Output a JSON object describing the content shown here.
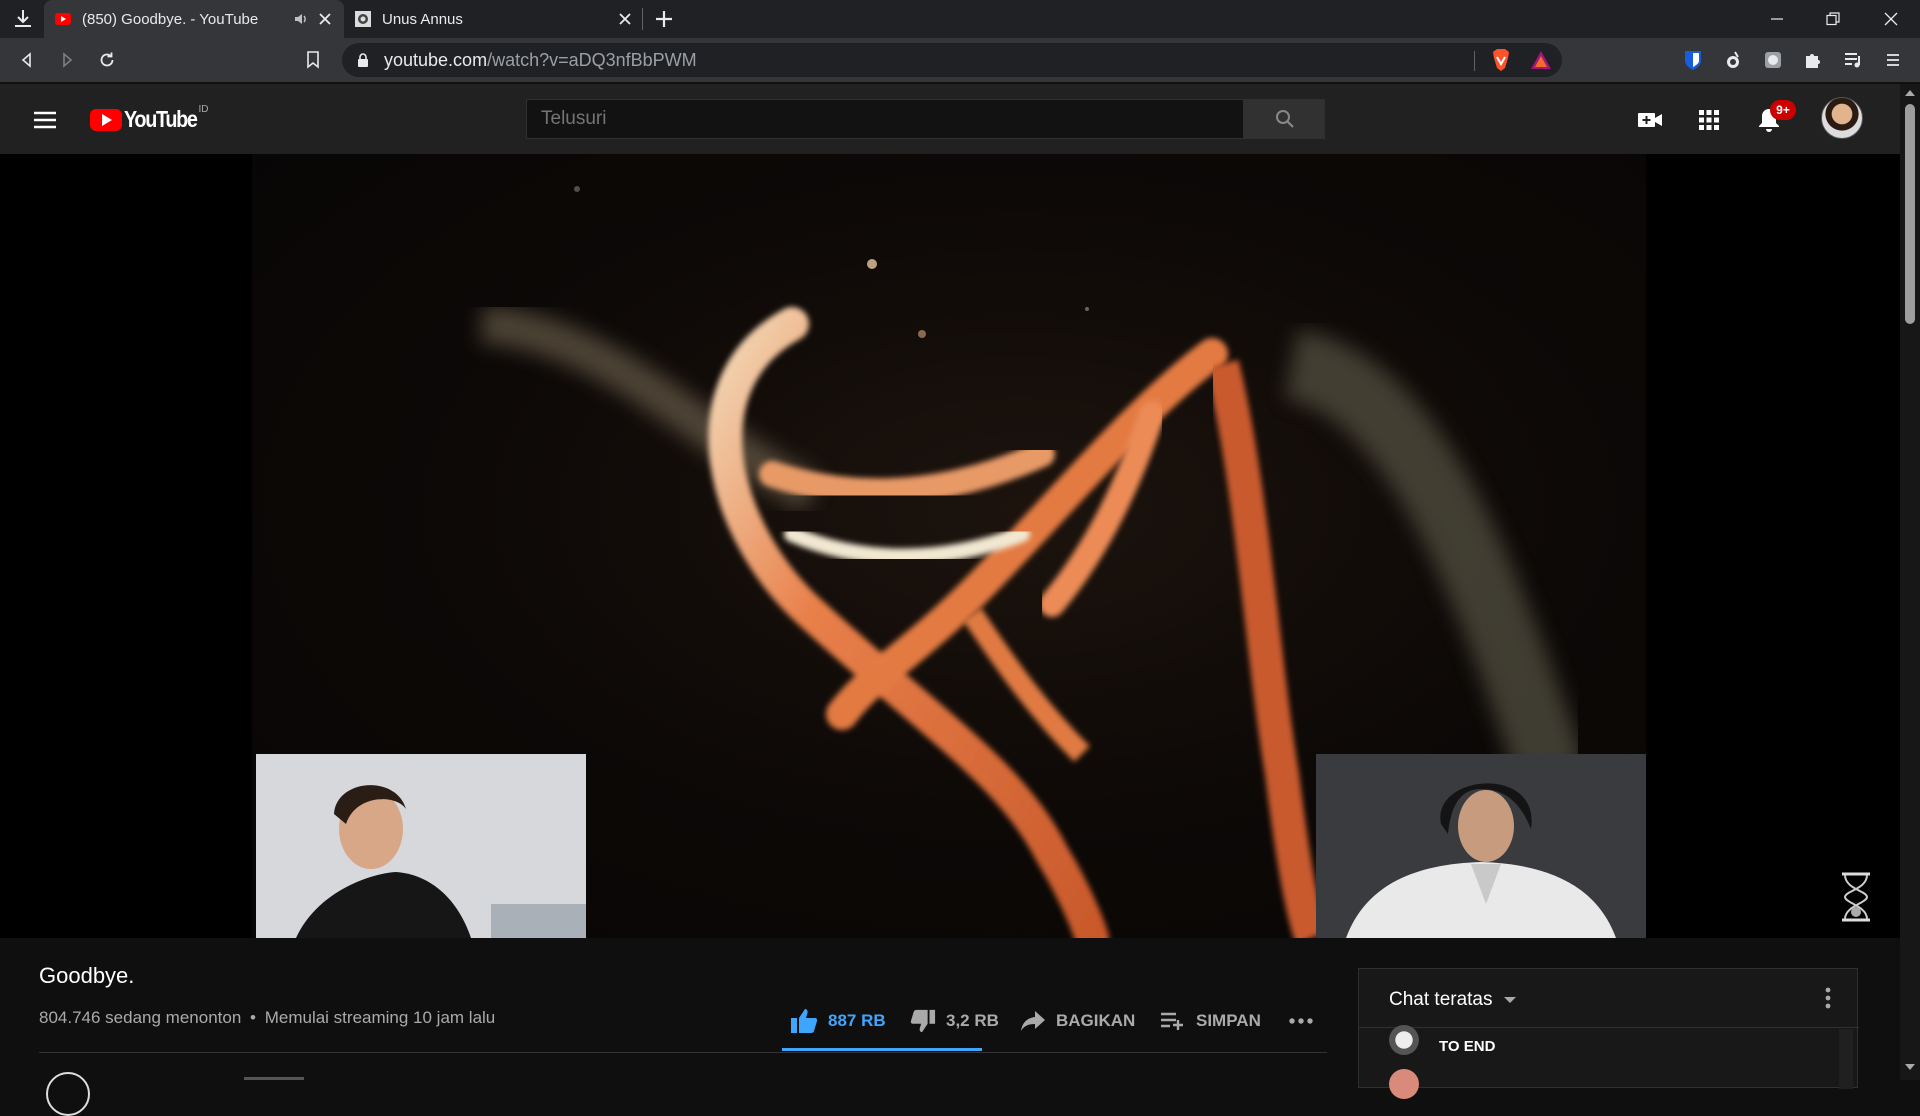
{
  "browser": {
    "tabs": [
      {
        "title": "(850) Goodbye. - YouTube",
        "active": true,
        "audio": true
      },
      {
        "title": "Unus Annus",
        "active": false
      }
    ],
    "url_host": "youtube.com",
    "url_path": "/watch?v=aDQ3nfBbPWM"
  },
  "youtube": {
    "logo_text": "YouTube",
    "region": "ID",
    "search_placeholder": "Telusuri",
    "notification_count": "9+"
  },
  "video": {
    "title": "Goodbye.",
    "viewers": "804.746 sedang menonton",
    "separator": "•",
    "started": "Memulai streaming 10 jam lalu",
    "like_count": "887 RB",
    "dislike_count": "3,2 RB",
    "share_label": "BAGIKAN",
    "save_label": "SIMPAN"
  },
  "chat": {
    "header": "Chat teratas",
    "message_visible": "TO END"
  },
  "colors": {
    "accent": "#3ea6ff",
    "yt_red": "#ff0000",
    "header_bg": "#212121"
  }
}
